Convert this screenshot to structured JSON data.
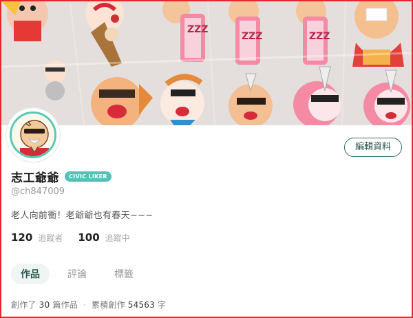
{
  "profile": {
    "display_name": "志工爺爺",
    "badge": "CIVIC LIKER",
    "handle": "@ch847009",
    "bio": "老人向前衝！老爺爺也有春天~~~",
    "edit_button": "編輯資料"
  },
  "stats": {
    "followers": {
      "count": "120",
      "label": "追蹤者"
    },
    "following": {
      "count": "100",
      "label": "追蹤中"
    }
  },
  "tabs": [
    {
      "label": "作品",
      "active": true
    },
    {
      "label": "評論",
      "active": false
    },
    {
      "label": "標籤",
      "active": false
    }
  ],
  "summary": {
    "prefix": "創作了",
    "works_count": "30",
    "works_suffix": "篇作品",
    "total_prefix": "累積創作",
    "total_count": "54563",
    "total_suffix": "字"
  },
  "cover_text": {
    "tag": "ZZZ"
  },
  "colors": {
    "accent": "#4fc3b6",
    "edit_border": "#2f6b63",
    "frame": "#e5292b"
  }
}
